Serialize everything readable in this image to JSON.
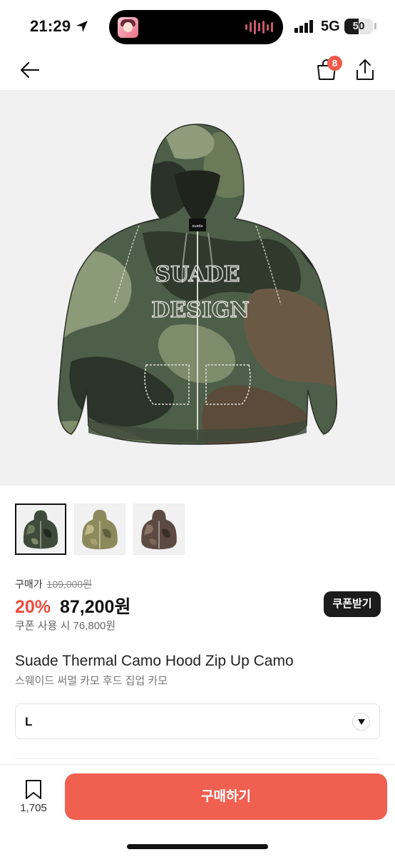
{
  "status_bar": {
    "time": "21:29",
    "network": "5G",
    "battery": "50",
    "battery_level": 0.5,
    "icons": [
      "location-arrow-icon",
      "signal-bars-icon",
      "battery-icon"
    ]
  },
  "header": {
    "icons": [
      "back-arrow-icon",
      "shopping-bag-icon",
      "share-icon"
    ],
    "cart_count": "8"
  },
  "product": {
    "thumbnails": [
      "camo-green-hoodie",
      "camo-olive-hoodie",
      "camo-brown-hoodie"
    ],
    "original_label": "구매가",
    "original_price": "109,000원",
    "discount": "20%",
    "price": "87,200원",
    "coupon_price": "쿠폰 사용 시 76,800원",
    "coupon_button": "쿠폰받기",
    "title_en": "Suade Thermal Camo Hood Zip Up Camo",
    "title_ko": "스웨이드 써멀 카모 후드 집업 카모",
    "hood_label": "suade",
    "print_line1": "SUADE",
    "print_line2": "DESIGN"
  },
  "option": {
    "selected": "L"
  },
  "bottom_bar": {
    "wishlist_count": "1,705",
    "buy_label": "구매하기"
  },
  "colors": {
    "accent": "#f06050",
    "discount": "#ef4b3c",
    "coupon_button_bg": "#1c1c1c"
  }
}
